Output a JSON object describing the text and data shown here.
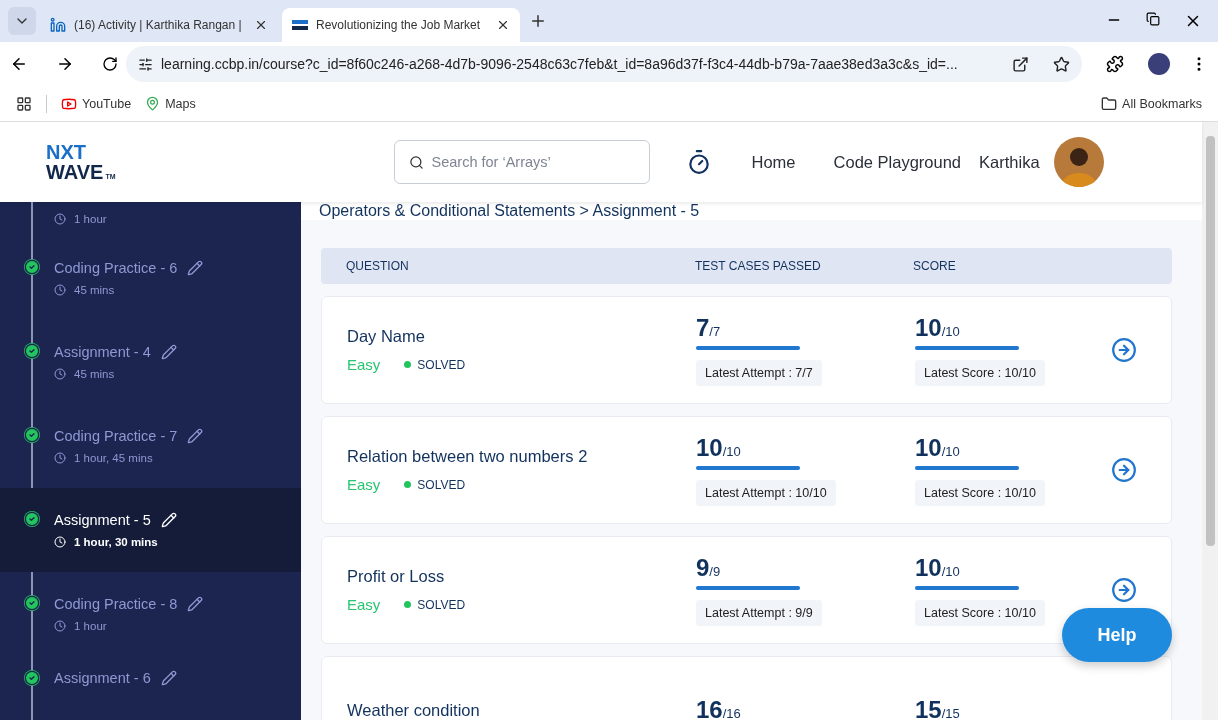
{
  "browser": {
    "tabs": [
      {
        "title": "(16) Activity | Karthika Rangan |",
        "kind": "linkedin",
        "selected": false
      },
      {
        "title": "Revolutionizing the Job Market",
        "kind": "nxtwave",
        "selected": true
      }
    ],
    "url": "learning.ccbp.in/course?c_id=8f60c246-a268-4d7b-9096-2548c63c7feb&t_id=8a96d37f-f3c4-44db-b79a-7aae38ed3a3c&s_id=...",
    "bookmarks": [
      {
        "label": "YouTube",
        "kind": "youtube"
      },
      {
        "label": "Maps",
        "kind": "maps"
      }
    ],
    "all_bookmarks": "All Bookmarks"
  },
  "header": {
    "logo_top": "NXT",
    "logo_bottom": "WAVE",
    "logo_tm": "TM",
    "search": {
      "placeholder": "Search for ‘Arrays’"
    },
    "nav": [
      "Home",
      "Code Playground"
    ],
    "user": "Karthika"
  },
  "sidebar": {
    "items": [
      {
        "duration": "1 hour",
        "selected": false
      },
      {
        "title": "Coding Practice - 6",
        "duration": "45 mins",
        "done": true,
        "selected": false
      },
      {
        "title": "Assignment - 4",
        "duration": "45 mins",
        "done": true,
        "selected": false
      },
      {
        "title": "Coding Practice - 7",
        "duration": "1 hour, 45 mins",
        "done": true,
        "selected": false
      },
      {
        "title": "Assignment - 5",
        "duration": "1 hour, 30 mins",
        "done": true,
        "selected": true
      },
      {
        "title": "Coding Practice - 8",
        "duration": "1 hour",
        "done": true,
        "selected": false
      },
      {
        "title": "Assignment - 6",
        "done": true,
        "selected": false
      }
    ]
  },
  "breadcrumb": "Operators & Conditional Statements > Assignment - 5",
  "table": {
    "columns": [
      "QUESTION",
      "TEST CASES PASSED",
      "SCORE"
    ],
    "rows": [
      {
        "title": "Day Name",
        "difficulty": "Easy",
        "status": "SOLVED",
        "passed": "7",
        "total": "/7",
        "tests_bar": {
          "level": 1
        },
        "attempt": "Latest Attempt : 7/7",
        "score": "10",
        "score_total": "/10",
        "score_bar": {
          "level": 1
        },
        "latest_score": "Latest Score : 10/10"
      },
      {
        "title": "Relation between two numbers 2",
        "difficulty": "Easy",
        "status": "SOLVED",
        "passed": "10",
        "total": "/10",
        "tests_bar": {
          "level": 1
        },
        "attempt": "Latest Attempt : 10/10",
        "score": "10",
        "score_total": "/10",
        "score_bar": {
          "level": 1
        },
        "latest_score": "Latest Score : 10/10"
      },
      {
        "title": "Profit or Loss",
        "difficulty": "Easy",
        "status": "SOLVED",
        "passed": "9",
        "total": "/9",
        "tests_bar": {
          "level": 1
        },
        "attempt": "Latest Attempt : 9/9",
        "score": "10",
        "score_total": "/10",
        "score_bar": {
          "level": 1
        },
        "latest_score": "Latest Score : 10/10"
      },
      {
        "title": "Weather condition",
        "passed": "16",
        "total": "/16",
        "score": "15",
        "score_total": "/15"
      }
    ]
  },
  "help": "Help"
}
